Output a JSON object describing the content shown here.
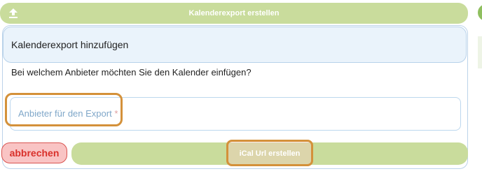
{
  "top_bar": {
    "label": "Kalenderexport erstellen",
    "icon": "upload-icon"
  },
  "dialog": {
    "title": "Kalenderexport hinzufügen",
    "question": "Bei welchem Anbieter möchten Sie den Kalender einfügen?",
    "provider_field": {
      "placeholder": "Anbieter für den Export",
      "required_mark": "*"
    }
  },
  "actions": {
    "cancel_label": "abbrechen",
    "create_label": "iCal Url erstellen"
  },
  "colors": {
    "primary_green": "#c9dc9c",
    "cancel_red": "#d9302a",
    "highlight_orange": "#d4913a",
    "field_border": "#bcd7ee"
  }
}
